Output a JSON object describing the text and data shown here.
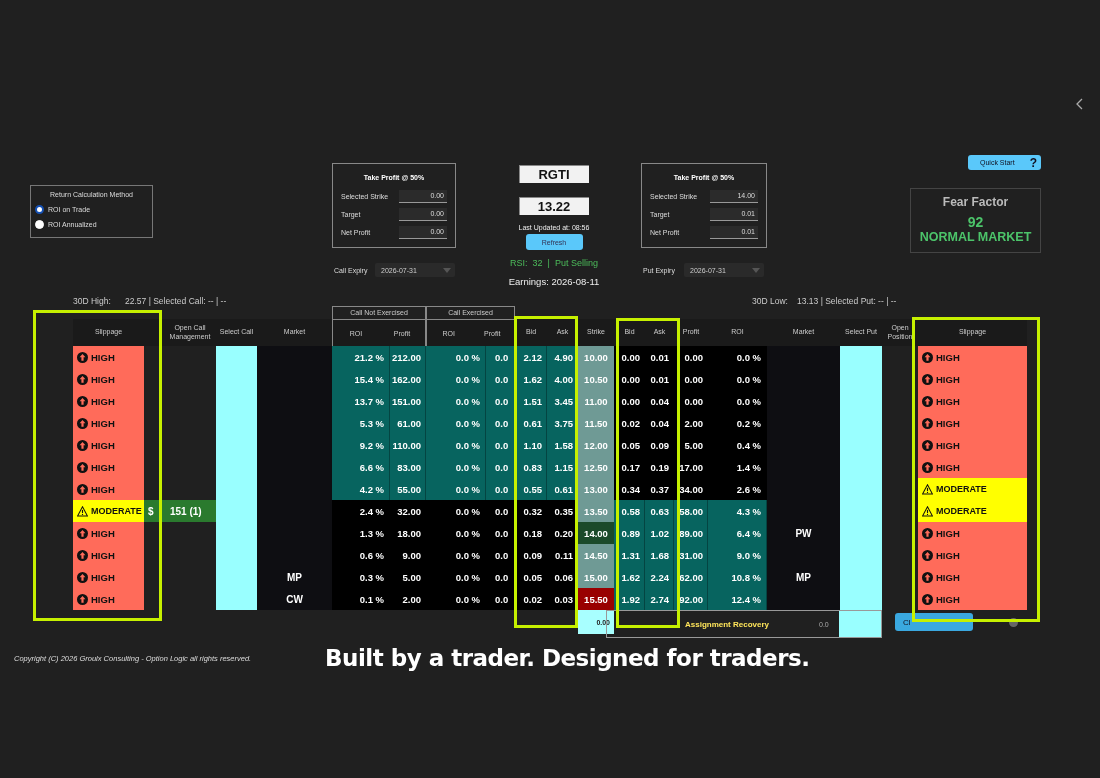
{
  "return_method": {
    "title": "Return Calculation Method",
    "options": [
      {
        "label": "ROI on Trade",
        "selected": true
      },
      {
        "label": "ROI Annualized",
        "selected": false
      }
    ]
  },
  "call_take_profit": {
    "title": "Take Profit @ 50%",
    "fields": [
      {
        "label": "Selected Strike",
        "value": "0.00"
      },
      {
        "label": "Target",
        "value": "0.00"
      },
      {
        "label": "Net Profit",
        "value": "0.00"
      }
    ]
  },
  "call_expiry": {
    "label": "Call Expiry",
    "value": "2026-07-31"
  },
  "ticker": {
    "symbol": "RGTI",
    "price": "13.22",
    "last_updated": "Last Updated at: 08:56",
    "refresh": "Refresh",
    "rsi": "RSI:  32  |  Put Selling",
    "earnings": "Earnings: 2026-08-11"
  },
  "put_take_profit": {
    "title": "Take Profit @ 50%",
    "fields": [
      {
        "label": "Selected Strike",
        "value": "14.00"
      },
      {
        "label": "Target",
        "value": "0.01"
      },
      {
        "label": "Net Profit",
        "value": "0.01"
      }
    ]
  },
  "put_expiry": {
    "label": "Put Expiry",
    "value": "2026-07-31"
  },
  "quick_start": {
    "label": "Quick Start",
    "help": "?"
  },
  "fear_factor": {
    "title": "Fear Factor",
    "value": "92",
    "status": "NORMAL MARKET"
  },
  "call_range": {
    "label": "30D High:",
    "value": "22.57 | Selected Call: -- | --"
  },
  "put_range": {
    "label": "30D Low:",
    "value": "13.13 | Selected Put: -- | --"
  },
  "table": {
    "columns": [
      {
        "label": "Slippage"
      },
      {
        "label": "Open Call Management"
      },
      {
        "label": "Select Call"
      },
      {
        "label": "Market"
      },
      {
        "group": "Call Not Exercised",
        "columns": [
          "ROI",
          "Profit"
        ]
      },
      {
        "group": "Call Exercised",
        "columns": [
          "ROI",
          "Profit"
        ]
      },
      {
        "label": "Bid"
      },
      {
        "label": "Ask"
      },
      {
        "label": "Strike"
      },
      {
        "label": "Bid"
      },
      {
        "label": "Ask"
      },
      {
        "label": "Profit"
      },
      {
        "label": "ROI"
      },
      {
        "label": "Market"
      },
      {
        "label": "Select Put"
      },
      {
        "label": "Open Position"
      },
      {
        "label": "Slippage"
      }
    ],
    "rows": [
      {
        "call_slippage": {
          "kind": "high",
          "label": "HIGH"
        },
        "call_itm": true,
        "cne_roi": "21.2 %",
        "cne_profit": "212.00",
        "ce_roi": "0.0 %",
        "ce_profit": "0.0",
        "call_bid": "2.12",
        "call_ask": "4.90",
        "strike": {
          "kind": "normal",
          "value": "10.00"
        },
        "put_itm": false,
        "put_bid": "0.00",
        "put_ask": "0.01",
        "put_profit": "0.00",
        "put_roi": "0.0 %",
        "put_slippage": {
          "kind": "high",
          "label": "HIGH"
        }
      },
      {
        "call_slippage": {
          "kind": "high",
          "label": "HIGH"
        },
        "call_itm": true,
        "cne_roi": "15.4 %",
        "cne_profit": "162.00",
        "ce_roi": "0.0 %",
        "ce_profit": "0.0",
        "call_bid": "1.62",
        "call_ask": "4.00",
        "strike": {
          "kind": "normal",
          "value": "10.50"
        },
        "put_itm": false,
        "put_bid": "0.00",
        "put_ask": "0.01",
        "put_profit": "0.00",
        "put_roi": "0.0 %",
        "put_slippage": {
          "kind": "high",
          "label": "HIGH"
        }
      },
      {
        "call_slippage": {
          "kind": "high",
          "label": "HIGH"
        },
        "call_itm": true,
        "cne_roi": "13.7 %",
        "cne_profit": "151.00",
        "ce_roi": "0.0 %",
        "ce_profit": "0.0",
        "call_bid": "1.51",
        "call_ask": "3.45",
        "strike": {
          "kind": "normal",
          "value": "11.00"
        },
        "put_itm": false,
        "put_bid": "0.00",
        "put_ask": "0.04",
        "put_profit": "0.00",
        "put_roi": "0.0 %",
        "put_slippage": {
          "kind": "high",
          "label": "HIGH"
        }
      },
      {
        "call_slippage": {
          "kind": "high",
          "label": "HIGH"
        },
        "call_itm": true,
        "cne_roi": "5.3 %",
        "cne_profit": "61.00",
        "ce_roi": "0.0 %",
        "ce_profit": "0.0",
        "call_bid": "0.61",
        "call_ask": "3.75",
        "strike": {
          "kind": "normal",
          "value": "11.50"
        },
        "put_itm": false,
        "put_bid": "0.02",
        "put_ask": "0.04",
        "put_profit": "2.00",
        "put_roi": "0.2 %",
        "put_slippage": {
          "kind": "high",
          "label": "HIGH"
        }
      },
      {
        "call_slippage": {
          "kind": "high",
          "label": "HIGH"
        },
        "call_itm": true,
        "cne_roi": "9.2 %",
        "cne_profit": "110.00",
        "ce_roi": "0.0 %",
        "ce_profit": "0.0",
        "call_bid": "1.10",
        "call_ask": "1.58",
        "strike": {
          "kind": "normal",
          "value": "12.00"
        },
        "put_itm": false,
        "put_bid": "0.05",
        "put_ask": "0.09",
        "put_profit": "5.00",
        "put_roi": "0.4 %",
        "put_slippage": {
          "kind": "high",
          "label": "HIGH"
        }
      },
      {
        "call_slippage": {
          "kind": "high",
          "label": "HIGH"
        },
        "call_itm": true,
        "cne_roi": "6.6 %",
        "cne_profit": "83.00",
        "ce_roi": "0.0 %",
        "ce_profit": "0.0",
        "call_bid": "0.83",
        "call_ask": "1.15",
        "strike": {
          "kind": "normal",
          "value": "12.50"
        },
        "put_itm": false,
        "put_bid": "0.17",
        "put_ask": "0.19",
        "put_profit": "17.00",
        "put_roi": "1.4 %",
        "put_slippage": {
          "kind": "high",
          "label": "HIGH"
        }
      },
      {
        "call_slippage": {
          "kind": "high",
          "label": "HIGH"
        },
        "call_itm": true,
        "cne_roi": "4.2 %",
        "cne_profit": "55.00",
        "ce_roi": "0.0 %",
        "ce_profit": "0.0",
        "call_bid": "0.55",
        "call_ask": "0.61",
        "strike": {
          "kind": "normal",
          "value": "13.00"
        },
        "put_itm": false,
        "put_bid": "0.34",
        "put_ask": "0.37",
        "put_profit": "34.00",
        "put_roi": "2.6 %",
        "put_slippage": {
          "kind": "moderate",
          "label": "MODERATE"
        }
      },
      {
        "call_slippage": {
          "kind": "moderate",
          "label": "MODERATE"
        },
        "open_call": {
          "sign": "$",
          "value": "151 (1)"
        },
        "call_itm": false,
        "cne_roi": "2.4 %",
        "cne_profit": "32.00",
        "ce_roi": "0.0 %",
        "ce_profit": "0.0",
        "call_bid": "0.32",
        "call_ask": "0.35",
        "strike": {
          "kind": "normal",
          "value": "13.50"
        },
        "put_itm": true,
        "put_bid": "0.58",
        "put_ask": "0.63",
        "put_profit": "58.00",
        "put_roi": "4.3 %",
        "put_slippage": {
          "kind": "moderate",
          "label": "MODERATE"
        }
      },
      {
        "call_slippage": {
          "kind": "high",
          "label": "HIGH"
        },
        "call_itm": false,
        "cne_roi": "1.3 %",
        "cne_profit": "18.00",
        "ce_roi": "0.0 %",
        "ce_profit": "0.0",
        "call_bid": "0.18",
        "call_ask": "0.20",
        "strike": {
          "kind": "selected",
          "value": "14.00"
        },
        "put_itm": true,
        "put_bid": "0.89",
        "put_ask": "1.02",
        "put_profit": "89.00",
        "put_roi": "6.4 %",
        "put_market": "PW",
        "put_slippage": {
          "kind": "high",
          "label": "HIGH"
        }
      },
      {
        "call_slippage": {
          "kind": "high",
          "label": "HIGH"
        },
        "call_itm": false,
        "cne_roi": "0.6 %",
        "cne_profit": "9.00",
        "ce_roi": "0.0 %",
        "ce_profit": "0.0",
        "call_bid": "0.09",
        "call_ask": "0.11",
        "strike": {
          "kind": "normal",
          "value": "14.50"
        },
        "put_itm": true,
        "put_bid": "1.31",
        "put_ask": "1.68",
        "put_profit": "31.00",
        "put_roi": "9.0 %",
        "put_slippage": {
          "kind": "high",
          "label": "HIGH"
        }
      },
      {
        "call_slippage": {
          "kind": "high",
          "label": "HIGH"
        },
        "call_market": "MP",
        "call_itm": false,
        "cne_roi": "0.3 %",
        "cne_profit": "5.00",
        "ce_roi": "0.0 %",
        "ce_profit": "0.0",
        "call_bid": "0.05",
        "call_ask": "0.06",
        "strike": {
          "kind": "normal",
          "value": "15.00"
        },
        "put_itm": true,
        "put_bid": "1.62",
        "put_ask": "2.24",
        "put_profit": "62.00",
        "put_roi": "10.8 %",
        "put_market": "MP",
        "put_slippage": {
          "kind": "high",
          "label": "HIGH"
        }
      },
      {
        "call_slippage": {
          "kind": "high",
          "label": "HIGH"
        },
        "call_market": "CW",
        "call_itm": false,
        "cne_roi": "0.1 %",
        "cne_profit": "2.00",
        "ce_roi": "0.0 %",
        "ce_profit": "0.0",
        "call_bid": "0.02",
        "call_ask": "0.03",
        "strike": {
          "kind": "alert",
          "value": "15.50"
        },
        "put_itm": true,
        "put_bid": "1.92",
        "put_ask": "2.74",
        "put_profit": "92.00",
        "put_roi": "12.4 %",
        "put_slippage": {
          "kind": "high",
          "label": "HIGH"
        }
      }
    ]
  },
  "footer_row": {
    "strike_total": "0.00",
    "assignment_recovery": {
      "label": "Assignment Recovery",
      "value": "0.0"
    },
    "button": "Cl"
  },
  "copyright": "Copyright (C) 2026 Groulx Consulting - Option Logic all rights reserved.",
  "tagline": "Built by a trader. Designed for traders."
}
